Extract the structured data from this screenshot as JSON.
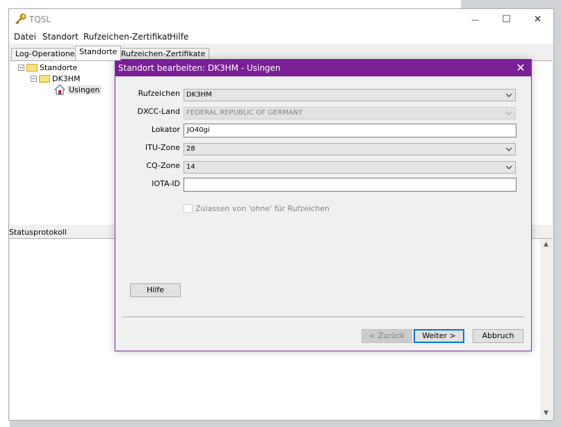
{
  "window": {
    "title": "TQSL",
    "controls": {
      "minimize": "—",
      "maximize": "☐",
      "close": "✕"
    }
  },
  "menubar": [
    "Datei",
    "Standort",
    "Rufzeichen-Zertifikat",
    "Hilfe"
  ],
  "tabs": [
    {
      "label": "Log-Operationen",
      "active": false
    },
    {
      "label": "Standorte",
      "active": true
    },
    {
      "label": "Rufzeichen-Zertifikate",
      "active": false
    }
  ],
  "tree": {
    "root": "Standorte",
    "callsign": "DK3HM",
    "location": "Usingen",
    "icons": {
      "folder": "folder-icon",
      "location": "house-icon"
    }
  },
  "status": {
    "label": "Statusprotokoll"
  },
  "dialog": {
    "title": "Standort bearbeiten: DK3HM - Usingen",
    "close": "✕",
    "fields": {
      "callsign": {
        "label": "Rufzeichen",
        "value": "DK3HM"
      },
      "dxcc": {
        "label": "DXCC-Land",
        "value": "FEDERAL REPUBLIC OF GERMANY"
      },
      "locator": {
        "label": "Lokator",
        "value": "JO40gi"
      },
      "itu": {
        "label": "ITU-Zone",
        "value": "28"
      },
      "cq": {
        "label": "CQ-Zone",
        "value": "14"
      },
      "iota": {
        "label": "IOTA-ID",
        "value": ""
      }
    },
    "checkbox_label": "Zulassen von 'ohne' für Rufzeichen",
    "buttons": {
      "help": "Hilfe",
      "back": "< Zurück",
      "next": "Weiter >",
      "cancel": "Abbruch"
    }
  },
  "colors": {
    "dialog_title": "#7a1f96",
    "folder": "#f7e27c",
    "default_button": "#0078d7"
  }
}
